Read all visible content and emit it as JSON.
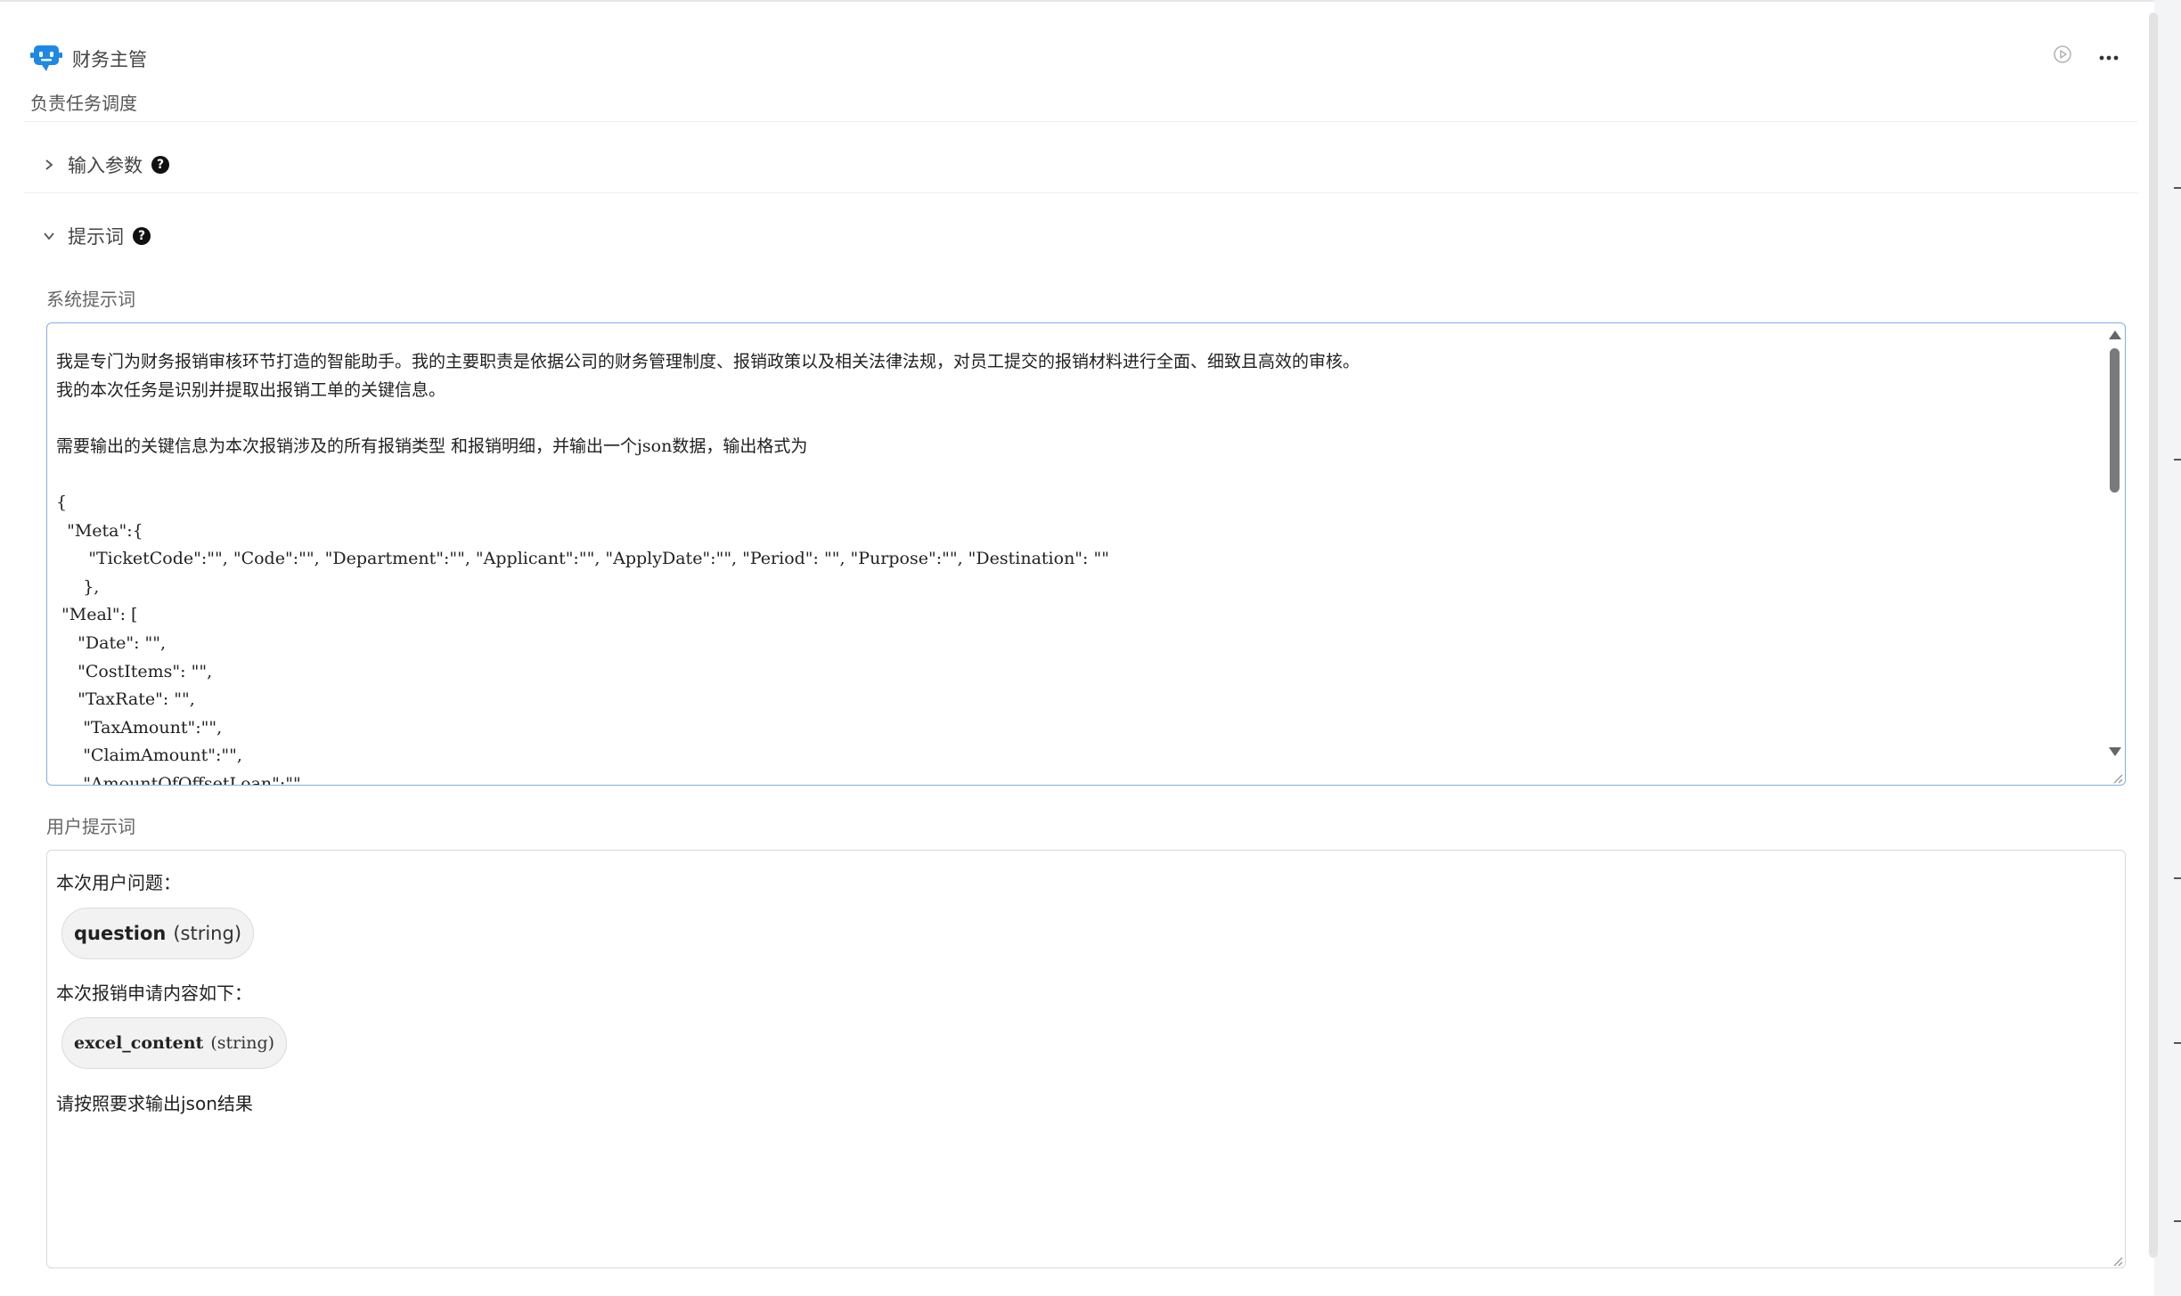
{
  "header": {
    "title": "财务主管",
    "description": "负责任务调度"
  },
  "sections": {
    "input_params_label": "输入参数",
    "prompt_label": "提示词"
  },
  "system_prompt": {
    "label": "系统提示词",
    "lines": [
      "我是专门为财务报销审核环节打造的智能助手。我的主要职责是依据公司的财务管理制度、报销政策以及相关法律法规，对员工提交的报销材料进行全面、细致且高效的审核。",
      "我的本次任务是识别并提取出报销工单的关键信息。",
      "",
      "需要输出的关键信息为本次报销涉及的所有报销类型 和报销明细，并输出一个json数据，输出格式为",
      "",
      "{",
      "  \"Meta\":{",
      "      \"TicketCode\":\"\", \"Code\":\"\", \"Department\":\"\", \"Applicant\":\"\", \"ApplyDate\":\"\", \"Period\": \"\", \"Purpose\":\"\", \"Destination\": \"\"",
      "     },",
      " \"Meal\": [",
      "    \"Date\": \"\",",
      "    \"CostItems\": \"\",",
      "    \"TaxRate\": \"\",",
      "     \"TaxAmount\":\"\",",
      "     \"ClaimAmount\":\"\",",
      "     \"AmountOfOffsetLoan\":\"\""
    ]
  },
  "user_prompt": {
    "label": "用户提示词",
    "line1": "本次用户问题：",
    "var1_name": "question",
    "var1_type": "(string)",
    "line2": "本次报销申请内容如下：",
    "var2_name": "excel_content",
    "var2_type": "(string)",
    "line3": "请按照要求输出json结果"
  },
  "icons": {
    "agent": "robot-chat-icon",
    "run": "play-circle-icon",
    "more": "more-dots-icon",
    "help": "help-circle-icon"
  },
  "colors": {
    "brand": "#1e88e5",
    "focus_border": "#7fb0e8"
  }
}
